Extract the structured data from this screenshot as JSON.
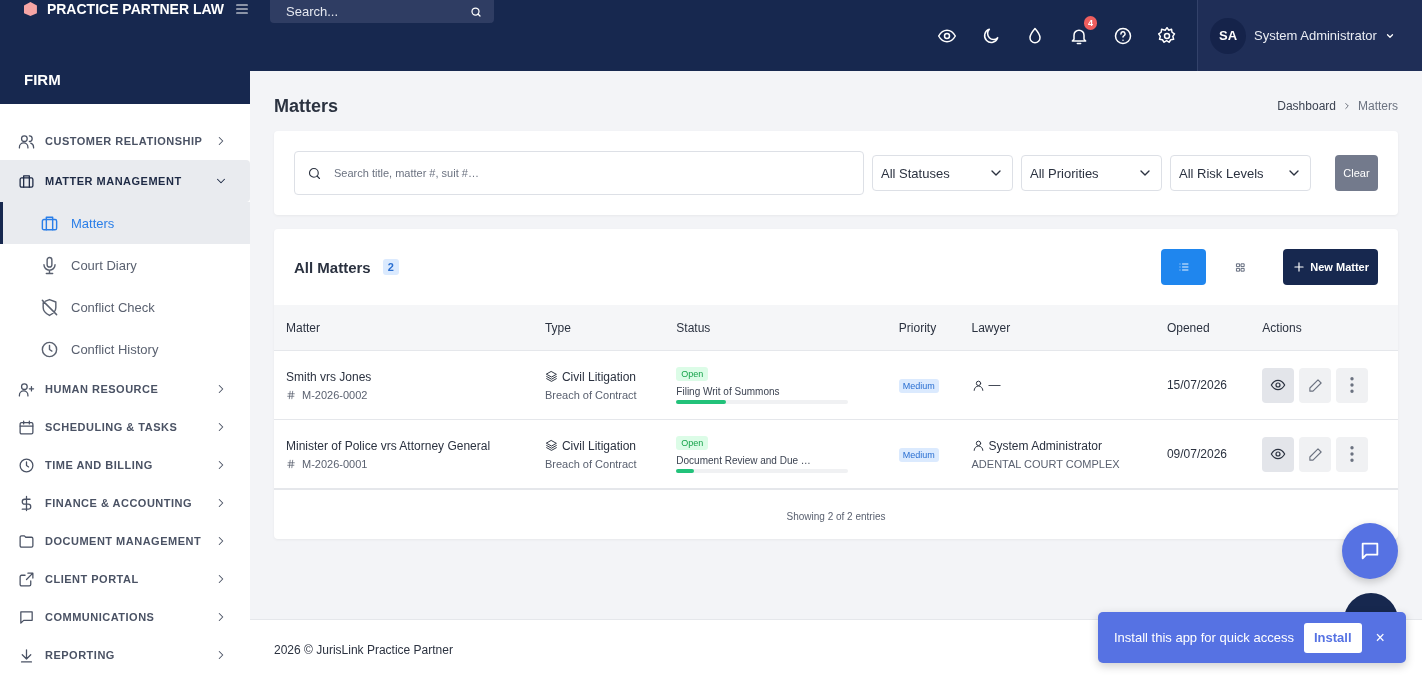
{
  "brand": {
    "name": "PRACTICE PARTNER LAW",
    "section": "FIRM"
  },
  "topbar": {
    "search": {
      "placeholder": "Search..."
    },
    "notifications": "4",
    "user": {
      "initials": "SA",
      "name": "System Administrator"
    }
  },
  "sidebar": {
    "items": [
      {
        "label": "CUSTOMER RELATIONSHIP",
        "expanded": false
      },
      {
        "label": "MATTER MANAGEMENT",
        "expanded": true,
        "children": [
          {
            "label": "Matters",
            "selected": true
          },
          {
            "label": "Court Diary",
            "selected": false
          },
          {
            "label": "Conflict Check",
            "selected": false
          },
          {
            "label": "Conflict History",
            "selected": false
          }
        ]
      },
      {
        "label": "HUMAN RESOURCE",
        "expanded": false
      },
      {
        "label": "SCHEDULING & TASKS",
        "expanded": false
      },
      {
        "label": "TIME AND BILLING",
        "expanded": false
      },
      {
        "label": "FINANCE & ACCOUNTING",
        "expanded": false
      },
      {
        "label": "DOCUMENT MANAGEMENT",
        "expanded": false
      },
      {
        "label": "CLIENT PORTAL",
        "expanded": false
      },
      {
        "label": "COMMUNICATIONS",
        "expanded": false
      },
      {
        "label": "REPORTING",
        "expanded": false
      }
    ]
  },
  "page": {
    "title": "Matters",
    "breadcrumb": [
      "Dashboard",
      "Matters"
    ]
  },
  "filters": {
    "search": {
      "placeholder": "Search title, matter #, suit #…"
    },
    "selects": [
      "All Statuses",
      "All Priorities",
      "All Risk Levels"
    ],
    "clear": "Clear"
  },
  "matters_card": {
    "title": "All Matters",
    "count": "2",
    "view_modes": [
      {
        "kind": "list",
        "selected": true
      },
      {
        "kind": "grid",
        "selected": false
      }
    ],
    "new_button": "New Matter",
    "columns": [
      "Matter",
      "Type",
      "Status",
      "Priority",
      "Lawyer",
      "Opened",
      "Actions"
    ],
    "rows": [
      {
        "title": "Smith vrs Jones",
        "number": "M-2026-0002",
        "type": "Civil Litigation",
        "subtype": "Breach of Contract",
        "status": "Open",
        "stage": "Filing Writ of Summons",
        "level": 0.29,
        "priority": "Medium",
        "lawyer": "—",
        "court": "",
        "opened": "15/07/2026"
      },
      {
        "title": "Minister of Police vrs Attorney General",
        "number": "M-2026-0001",
        "type": "Civil Litigation",
        "subtype": "Breach of Contract",
        "status": "Open",
        "stage": "Document Review and Due …",
        "level": 0.1,
        "priority": "Medium",
        "lawyer": "System Administrator",
        "court": "ADENTAL COURT COMPLEX",
        "opened": "09/07/2026"
      }
    ],
    "footer": "Showing 2 of 2 entries"
  },
  "footer": "2026 © JurisLink Practice Partner",
  "install_banner": {
    "text": "Install this app for quick access",
    "button": "Install",
    "close": "×"
  }
}
